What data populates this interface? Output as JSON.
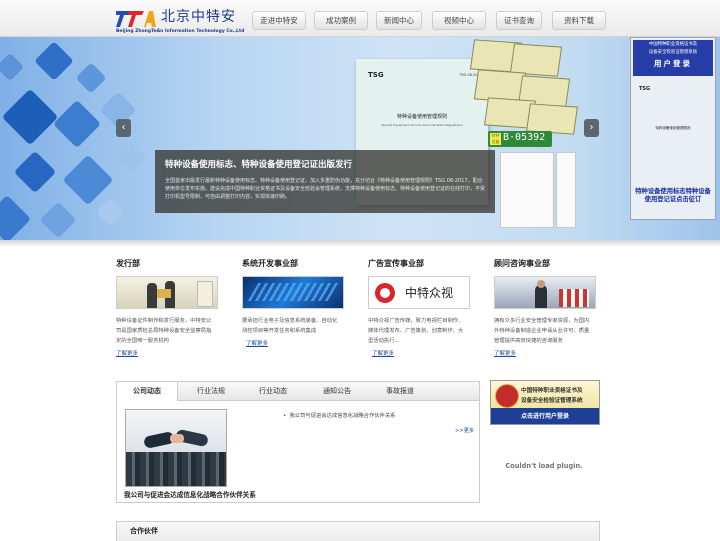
{
  "logo": {
    "name_cn": "北京中特安",
    "name_en": "Beijing ZhongTeAn Information Technology Co.,Ltd"
  },
  "nav": {
    "items": [
      {
        "label": "走进中特安"
      },
      {
        "label": "成功案例"
      },
      {
        "label": "新闻中心"
      },
      {
        "label": "视频中心"
      },
      {
        "label": "证书查询"
      },
      {
        "label": "资料下载"
      }
    ]
  },
  "banner": {
    "caption_title": "特种设备使用标志、特种设备使用登记证出版发行",
    "caption_desc": "全国首家出版发行最新特种设备使用标志、特种设备使用登记证，加入多重防伪功能，充分切合《特种设备使用管理规则》TSG 08-2017，配合使用单位发布实施。建设完成中国特种职业资格证书及设备安全检验会管理系统，支撑特种设备使用标志、特种设备使用登记证的在线打印，不受打印机型号限制，可自由调整打印内容，实现快速印刷。",
    "doc_tsg": "TSG",
    "doc_no": "TSG 08-2017",
    "doc_title": "特种设备使用管理规则",
    "doc_subtitle": "Special Equipment Service Administrative Regulations",
    "plate_text": "B·05392",
    "plate_tag": "特种设备",
    "prev_icon": "‹",
    "next_icon": "›"
  },
  "login_panel": {
    "header_line1": "中国特种职业资格证书及",
    "header_line2": "设备安全检验证管理系统",
    "header_main": "用户登录",
    "tsg": "TSG",
    "doc_title": "特种设备使用管理规则",
    "footer": "特种设备使用标志特种设备使用登记证点击征订"
  },
  "sections": [
    {
      "title": "发行部",
      "desc": "特种设备证件制作和发行服务，中特安公司是国家质检总局特种设备安全监察局指定的全国唯一服务机构",
      "more": "了解更多"
    },
    {
      "title": "系统开发事业部",
      "desc": "要承担行业电子及信息系统装备、自动化测控项目等开发任务和系统集成",
      "more": "了解更多"
    },
    {
      "title": "广告宣传事业部",
      "desc": "中特众视广告传媒，致力电视栏目制作、媒体代理发布、广告策划、创意制作、大型活动执行...",
      "more": "了解更多",
      "image_text": "中特众视"
    },
    {
      "title": "顾问咨询事业部",
      "desc": "拥有众多行业安全管理专家资源，为国内外特种设备制造企业申请从业许可、质量管理提供高效快捷的咨询服务",
      "more": "了解更多"
    }
  ],
  "news": {
    "tabs": [
      {
        "label": "公司动态"
      },
      {
        "label": "行业法规"
      },
      {
        "label": "行业动态"
      },
      {
        "label": "通知公告"
      },
      {
        "label": "事故报道"
      }
    ],
    "active_tab": "公司动态",
    "image_caption": "我公司与促进会达成信息化战略合作伙伴关系",
    "item": "我公司与促进会达成信息化战略合作伙伴关系",
    "more": ">>更多"
  },
  "side_ad": {
    "line1": "中国特种职业资格证书及",
    "line2": "设备安全检验证管理系统",
    "line3": "点击进行用户登录"
  },
  "plugin_message": "Couldn't load plugin.",
  "partners_title": "合作伙伴",
  "colors": {
    "link": "#1a4d99",
    "logo_blue": "#1a3a8a",
    "login_blue": "#263ca7"
  }
}
